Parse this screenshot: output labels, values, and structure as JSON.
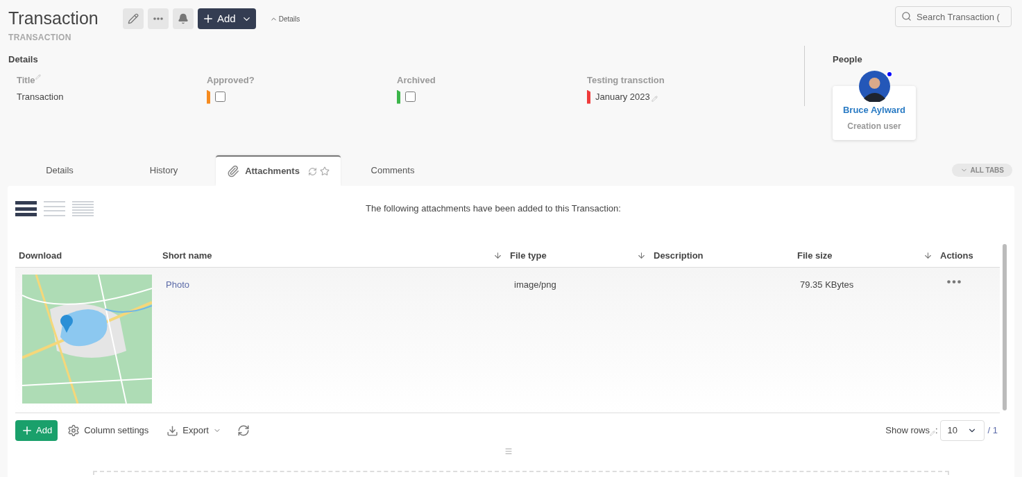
{
  "header": {
    "title": "Transaction",
    "subtitle": "TRANSACTION",
    "toolbar": [
      {
        "kind": "edit"
      },
      {
        "kind": "more"
      },
      {
        "kind": "bell"
      },
      {
        "kind": "add",
        "label": "Add"
      }
    ],
    "details_toggle": "Details",
    "search": {
      "placeholder": "Search Transaction ("
    }
  },
  "details": {
    "heading": "Details",
    "fields": [
      {
        "kind": "text",
        "label": "Title",
        "value": "Transaction"
      },
      {
        "kind": "checkbox",
        "label": "Approved?",
        "color": "#f68b1f",
        "checked": false
      },
      {
        "kind": "checkbox",
        "label": "Archived",
        "color": "#3cb54a",
        "checked": false
      },
      {
        "kind": "date",
        "label": "Testing transction",
        "color": "#ef3b3b",
        "value": "January 2023"
      }
    ]
  },
  "people": {
    "heading": "People",
    "cards": [
      {
        "name": "Bruce Aylward",
        "role": "Creation user",
        "online": true
      }
    ]
  },
  "tabs": [
    {
      "label": "Details",
      "selected": false
    },
    {
      "label": "History",
      "selected": false
    },
    {
      "label": "Attachments",
      "selected": true
    },
    {
      "label": "Comments",
      "selected": false
    }
  ],
  "all_tabs": "ALL TABS",
  "attachments": {
    "view_modes": [
      {
        "selected": true
      },
      {
        "selected": false
      },
      {
        "selected": false
      }
    ],
    "caption": "The following attachments have been added to this Transaction:",
    "columns": [
      {
        "label": "Download",
        "sortable": false
      },
      {
        "label": "Short name",
        "sortable": true
      },
      {
        "label": "File type",
        "sortable": true
      },
      {
        "label": "Description",
        "sortable": false
      },
      {
        "label": "File size",
        "sortable": true
      },
      {
        "label": "Actions",
        "sortable": false
      }
    ],
    "rows": [
      {
        "short_name": "Photo",
        "file_type": "image/png",
        "file_size": "79.35 KBytes"
      }
    ],
    "footer": {
      "add": "Add",
      "column_settings": "Column settings",
      "export": "Export",
      "show_rows": "Show rows",
      "separator": ":",
      "rows_value": "10",
      "pages": "/ 1"
    }
  }
}
